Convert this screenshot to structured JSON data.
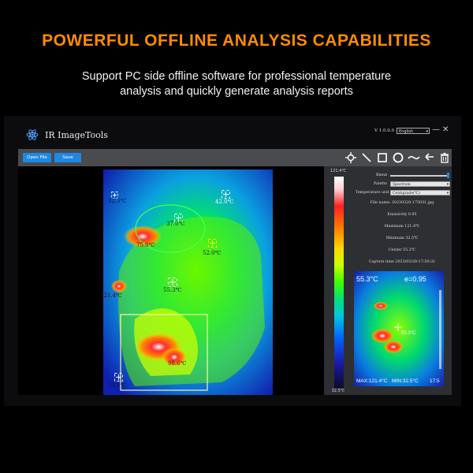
{
  "banner": {
    "headline": "POWERFUL OFFLINE ANALYSIS CAPABILITIES",
    "subline1": "Support PC side offline software for professional temperature",
    "subline2": "analysis and quickly generate analysis reports"
  },
  "app": {
    "title": "IR ImageTools",
    "version": "V 1.0.0.0",
    "language": "English",
    "minimize": "—",
    "close": "✕"
  },
  "toolbar": {
    "open_file": "Open File",
    "save": "Save",
    "tools": [
      "crosshair-tool-icon",
      "line-tool-icon",
      "rectangle-tool-icon",
      "ellipse-tool-icon",
      "curve-tool-icon",
      "undo-icon",
      "delete-icon"
    ]
  },
  "image": {
    "markers": [
      {
        "label": "32.5℃",
        "kind": "cold"
      },
      {
        "label": "42.0℃",
        "kind": "cold"
      },
      {
        "label": "37.0℃",
        "kind": "cold"
      },
      {
        "label": "52.0℃",
        "kind": "hot"
      },
      {
        "label": "55.3℃",
        "kind": "center"
      },
      {
        "label": "33.8℃",
        "kind": "cold"
      }
    ],
    "region_labels": [
      "75.0℃",
      "121.4℃",
      "98.6℃"
    ]
  },
  "scale": {
    "max": "121.4℃",
    "min": "32.5℃"
  },
  "props": {
    "blend_label": "Blend",
    "palette_label": "Palette",
    "palette_value": "Spectrum",
    "unit_label": "Temperature unit",
    "unit_value": "Centigrade(℃)",
    "file_name": "File name: 20230320-175031.jpg",
    "emissivity": "Emissivity 0.95",
    "maximum": "Maximum 121.4℃",
    "minimum": "Minimum 32.5℃",
    "center": "Center 55.3℃",
    "capture_time": "Capture time 2023/03/20-17:50:31"
  },
  "preview": {
    "center_temp": "55.3°C",
    "emissivity": "e=0.95",
    "center_label": "55.3°C",
    "max_text": "MAX:121.4°C",
    "min_text": "MIN:32.5°C",
    "time": "17:5"
  },
  "colors": {
    "headline": "#ff8c00",
    "button": "#1e88e5",
    "toolbar": "#4a4b4f",
    "panel": "#2e2f33"
  }
}
